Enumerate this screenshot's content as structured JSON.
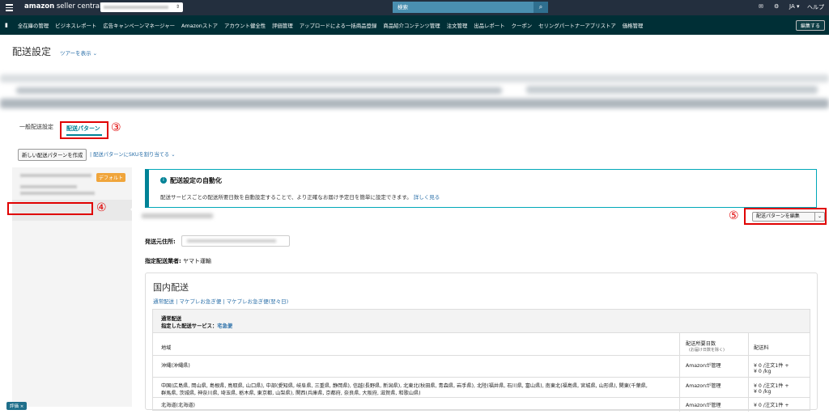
{
  "header": {
    "logo_bold": "amazon",
    "logo_rest": " seller central",
    "search_placeholder": "検索",
    "lang": "JA",
    "help": "ヘルプ"
  },
  "nav": {
    "items": [
      "全在庫の管理",
      "ビジネスレポート",
      "広告キャンペーンマネージャー",
      "Amazonストア",
      "アカウント健全性",
      "評価管理",
      "アップロードによる一括商品登録",
      "商品紹介コンテンツ管理",
      "注文管理",
      "出品レポート",
      "クーポン",
      "セリングパートナーアプリストア",
      "価格管理"
    ],
    "edit_label": "編集する"
  },
  "page": {
    "title": "配送設定",
    "tour_link": "ツアーを表示 ⌄"
  },
  "tabs": {
    "general": "一般配送設定",
    "patterns": "配送パターン"
  },
  "annotations": {
    "n3": "③",
    "n4": "④",
    "n5": "⑤"
  },
  "actions": {
    "new_pattern": "新しい配送パターンを作成",
    "assign_sku": "| 配送パターンにSKUを割り当てる ⌄"
  },
  "left_pane": {
    "default_badge": "デフォルト"
  },
  "info": {
    "icon": "i",
    "heading": "配送設定の自動化",
    "body": "配送サービスごとの配送所要日数を自動設定することで、より正確なお届け予定日を簡単に設定できます。",
    "link": "詳しく見る"
  },
  "pattern": {
    "edit_button": "配送パターンを編集",
    "from_label": "発送元住所:",
    "carrier_label": "指定配送業者:",
    "carrier_value": "ヤマト運輸"
  },
  "domestic": {
    "title": "国内配送",
    "links": "通常配送 | マケプレお急ぎ便 | マケプレお急ぎ便(翌々日)",
    "section_name": "通常配送",
    "service_label": "指定した配送サービス：",
    "service_value": "宅急便",
    "col_region": "地域",
    "col_days": "配送所要日数",
    "col_days_sub": "(お届け日数を除く)",
    "col_fee": "配送料",
    "rows": [
      {
        "region": "沖縄(沖縄県)",
        "days": "Amazonが管理",
        "fee1": "¥ 0 /注文1件 +",
        "fee2": "¥ 0 /kg"
      },
      {
        "region": "中国(広島県, 岡山県, 島根県, 鳥取県, 山口県), 中部(愛知県, 岐阜県, 三重県, 静岡県), 信越(長野県, 新潟県), 北東北(秋田県, 青森県, 岩手県), 北陸(福井県, 石川県, 富山県), 南東北(福島県, 宮城県, 山形県), 関東(千葉県,",
        "region2": "群馬県, 茨城県, 神奈川県, 埼玉県, 栃木県, 東京都, 山梨県), 関西(兵庫県, 京都府, 奈良県, 大阪府, 滋賀県, 和歌山県)",
        "days": "Amazonが管理",
        "fee1": "¥ 0 /注文1件 +",
        "fee2": "¥ 0 /kg"
      },
      {
        "region": "北海道(北海道)",
        "days": "Amazonが管理",
        "fee1": "¥ 0 /注文1件 +",
        "fee2": ""
      }
    ]
  },
  "footer_badge": "評価 ×"
}
